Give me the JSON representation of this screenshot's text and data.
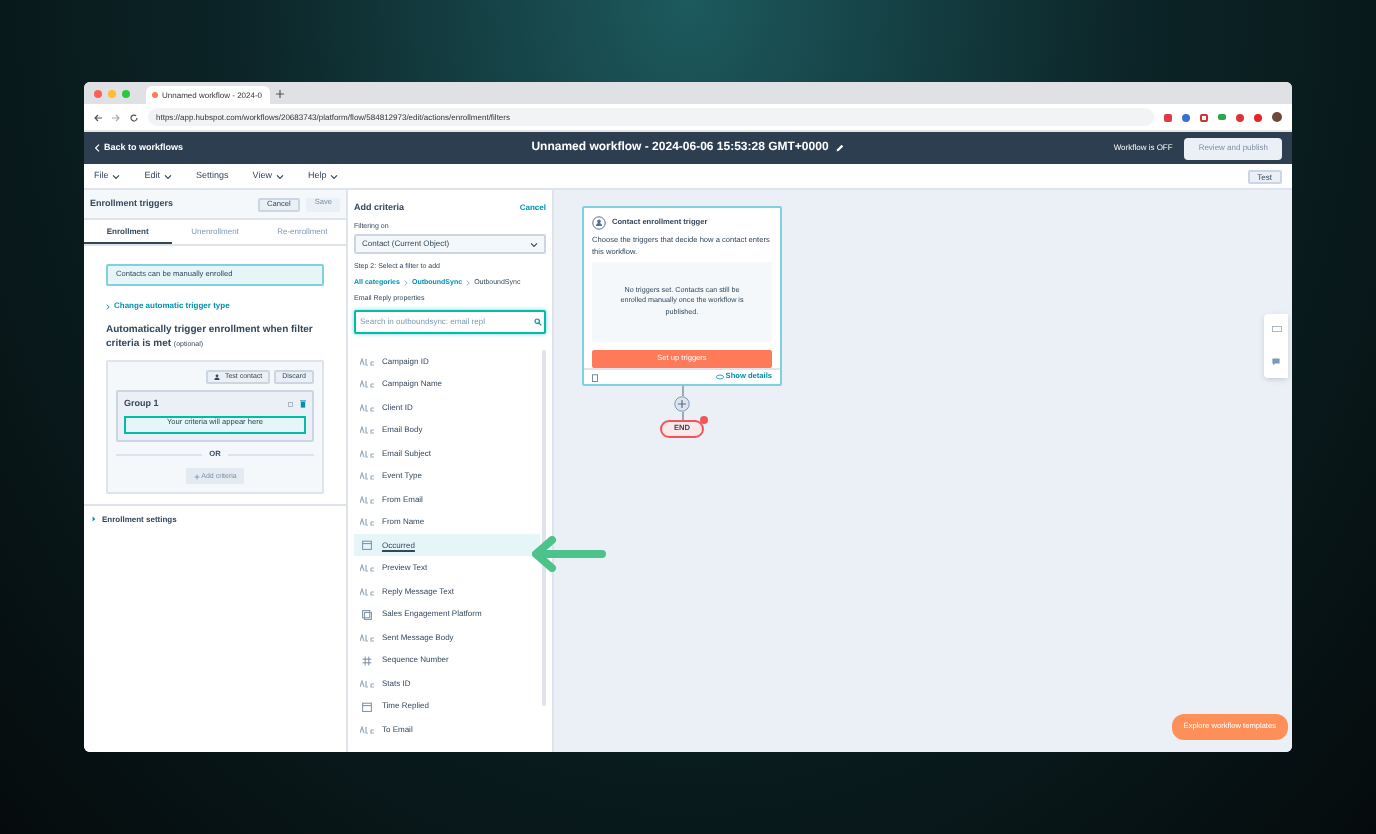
{
  "browser": {
    "tab_title": "Unnamed workflow - 2024-0",
    "url": "https://app.hubspot.com/workflows/20683743/platform/flow/584812973/edit/actions/enrollment/filters"
  },
  "header": {
    "back": "Back to workflows",
    "title": "Unnamed workflow - 2024-06-06 15:53:28 GMT+0000",
    "status": "Workflow is OFF",
    "publish": {
      "label": "Review and publish",
      "disabled": true
    }
  },
  "menu": [
    "File",
    "Edit",
    "Settings",
    "View",
    "Help"
  ],
  "test_button": "Test",
  "enrollment_panel": {
    "title": "Enrollment triggers",
    "cancel": "Cancel",
    "save": {
      "label": "Save",
      "disabled": true
    },
    "tabs": [
      {
        "label": "Enrollment",
        "selected": true
      },
      {
        "label": "Unenrollment",
        "selected": false
      },
      {
        "label": "Re-enrollment",
        "selected": false
      }
    ],
    "info": "Contacts can be manually enrolled",
    "change_link": "Change automatic trigger type",
    "heading": "Automatically trigger enrollment when filter criteria is met",
    "optional": "(optional)",
    "test_contact": "Test contact",
    "discard": "Discard",
    "group_title": "Group 1",
    "criteria_placeholder": "Your criteria will appear here",
    "or": "OR",
    "add_criteria": {
      "label": "Add criteria",
      "disabled": true
    },
    "settings": "Enrollment settings"
  },
  "criteria_panel": {
    "title": "Add criteria",
    "cancel": "Cancel",
    "filtering_label": "Filtering on",
    "filtering_value": "Contact (Current Object)",
    "step": "Step 2: Select a filter to add",
    "breadcrumb": [
      "All categories",
      "OutboundSync",
      "OutboundSync"
    ],
    "group_label": "Email Reply properties",
    "search_placeholder": "Search in outboundsync: email repl",
    "items": [
      {
        "label": "Campaign ID",
        "kind": "text",
        "selected": false
      },
      {
        "label": "Campaign Name",
        "kind": "text",
        "selected": false
      },
      {
        "label": "Client ID",
        "kind": "text",
        "selected": false
      },
      {
        "label": "Email Body",
        "kind": "text",
        "selected": false
      },
      {
        "label": "Email Subject",
        "kind": "text",
        "selected": false
      },
      {
        "label": "Event Type",
        "kind": "text",
        "selected": false
      },
      {
        "label": "From Email",
        "kind": "text",
        "selected": false
      },
      {
        "label": "From Name",
        "kind": "text",
        "selected": false
      },
      {
        "label": "Occurred",
        "kind": "date",
        "selected": true
      },
      {
        "label": "Preview Text",
        "kind": "text",
        "selected": false
      },
      {
        "label": "Reply Message Text",
        "kind": "text",
        "selected": false
      },
      {
        "label": "Sales Engagement Platform",
        "kind": "select",
        "selected": false
      },
      {
        "label": "Sent Message Body",
        "kind": "text",
        "selected": false
      },
      {
        "label": "Sequence Number",
        "kind": "number",
        "selected": false
      },
      {
        "label": "Stats ID",
        "kind": "text",
        "selected": false
      },
      {
        "label": "Time Replied",
        "kind": "date",
        "selected": false
      },
      {
        "label": "To Email",
        "kind": "text",
        "selected": false
      }
    ]
  },
  "canvas": {
    "trigger_card": {
      "title": "Contact enrollment trigger",
      "description": "Choose the triggers that decide how a contact enters this workflow.",
      "empty_note": "No triggers set. Contacts can still be enrolled manually once the workflow is published.",
      "setup_button": "Set up triggers",
      "details_link": "Show details"
    },
    "end_label": "END",
    "templates_button": "Explore workflow templates"
  }
}
